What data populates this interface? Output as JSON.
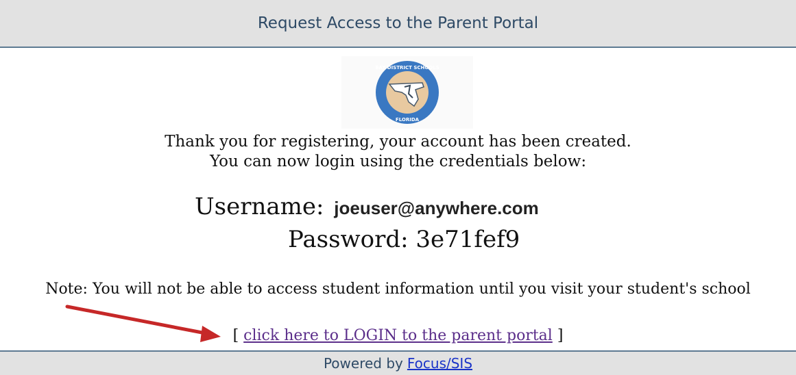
{
  "header": {
    "title": "Request Access to the Parent Portal"
  },
  "logo": {
    "icon": "school-district-seal-icon",
    "colors": {
      "ring": "#3a78c2",
      "inner": "#e8c9a0",
      "land": "#ffffff"
    }
  },
  "message": {
    "thanks": "Thank you for registering, your account has been created.",
    "can_login": "You can now login using the credentials below:"
  },
  "credentials": {
    "username_label": "Username:",
    "username_value": "joeuser@anywhere.com",
    "password_label": "Password:",
    "password_value": "3e71fef9"
  },
  "note": {
    "text": "Note: You will not be able to access student information until you visit your student's school"
  },
  "login": {
    "open_bracket": "[",
    "link_text": "click here to LOGIN to the parent portal",
    "close_bracket": "]"
  },
  "annotation": {
    "arrow_color": "#c62828"
  },
  "footer": {
    "prefix": "Powered by",
    "link_text": "Focus/SIS"
  },
  "theme": {
    "bar_background": "#e2e2e2",
    "bar_border": "#5d7a92",
    "link_visited": "#5b2e8a",
    "link": "#1a33c8"
  }
}
